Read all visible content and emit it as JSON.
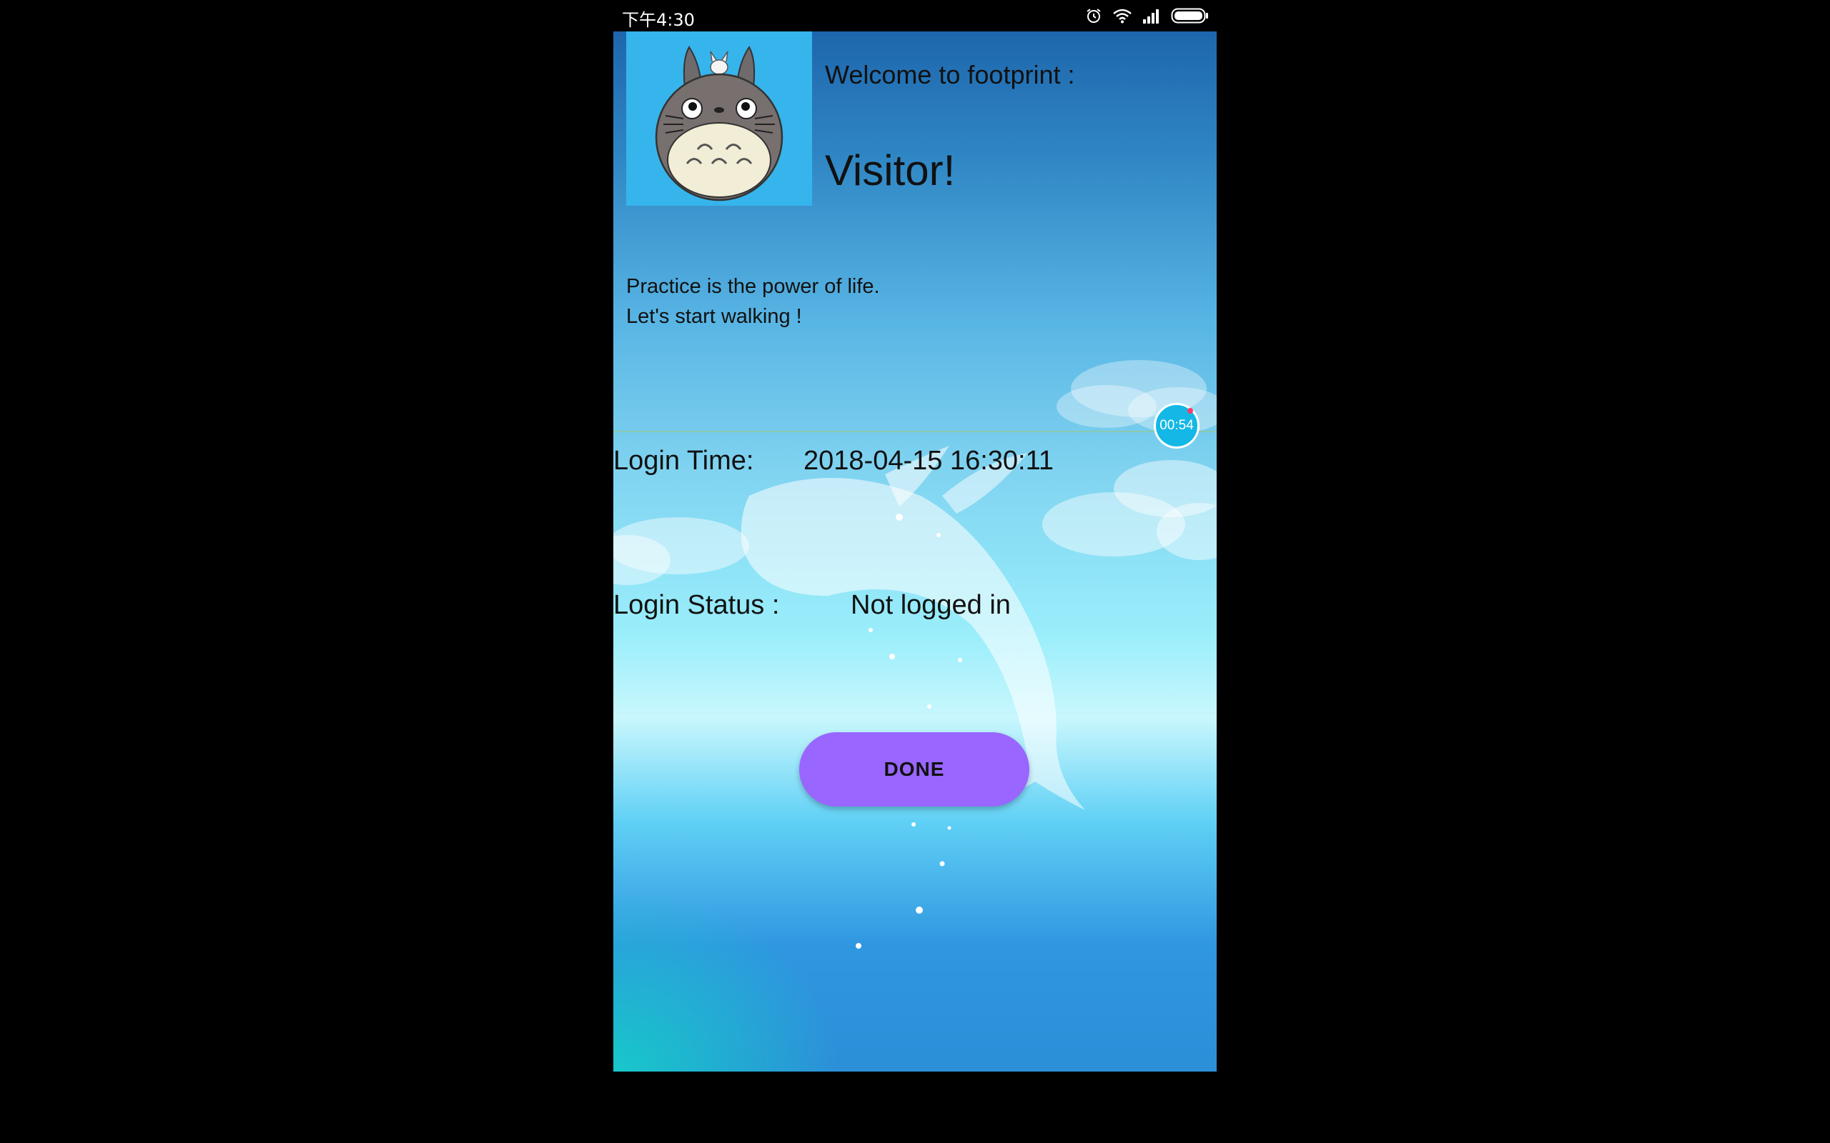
{
  "status_bar": {
    "time": "下午4:30",
    "icons": [
      "alarm-icon",
      "wifi-icon",
      "signal-icon",
      "battery-icon"
    ]
  },
  "header": {
    "welcome": "Welcome to footprint :",
    "user": "Visitor!"
  },
  "motto": {
    "line1": "Practice is the power of life.",
    "line2": "Let's start walking !"
  },
  "login_time": {
    "label": "Login Time:",
    "value": "2018-04-15 16:30:11"
  },
  "login_status": {
    "label": "Login Status :",
    "value": "Not logged in"
  },
  "done_label": "DONE",
  "timer": "00:54",
  "colors": {
    "button": "#9966ff",
    "avatar_bg": "#36b4ec",
    "timer_bg": "#14b8e6"
  }
}
